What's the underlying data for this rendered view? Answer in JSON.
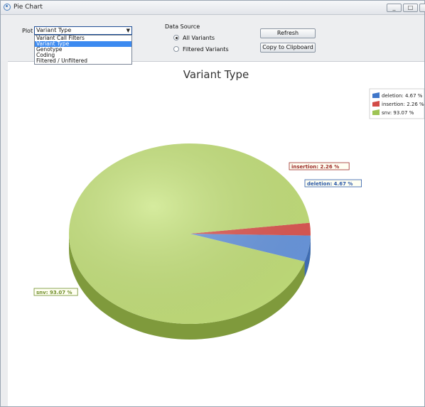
{
  "window": {
    "title": "Pie Chart",
    "minimize_glyph": "_",
    "maximize_glyph": "□",
    "close_glyph": "X"
  },
  "toolbar": {
    "plot_label": "Plot",
    "plot_selected": "Variant Type",
    "plot_options": [
      "Variant Call Filters",
      "Variant Type",
      "Genotype",
      "Coding",
      "Filtered / Unfiltered"
    ],
    "plot_selected_index": 1,
    "data_source_label": "Data Source",
    "data_source_options": [
      "All Variants",
      "Filtered Variants"
    ],
    "data_source_selected": "All Variants",
    "refresh_label": "Refresh",
    "copy_label": "Copy to Clipboard"
  },
  "icons": {
    "app": "pie-chart-app-icon",
    "dropdown": "chevron-down-icon"
  },
  "chart_data": {
    "type": "pie",
    "title": "Variant Type",
    "slices": [
      {
        "name": "deletion",
        "value": 4.67,
        "label": "deletion: 4.67 %",
        "color": "#6c9be4",
        "side_color": "#3f6cb3",
        "label_color": "#2a58a8"
      },
      {
        "name": "insertion",
        "value": 2.26,
        "label": "insertion: 2.26 %",
        "color": "#e25a55",
        "side_color": "#a63a36",
        "label_color": "#9c2b27"
      },
      {
        "name": "snv",
        "value": 93.07,
        "label": "snv: 93.07 %",
        "color": "#c8e57e",
        "side_color": "#7f9a3c",
        "label_color": "#6f8e2a"
      }
    ],
    "legend": {
      "position": "top-right",
      "entries": [
        "deletion: 4.67 %",
        "insertion: 2.26 %",
        "snv: 93.07 %"
      ],
      "colors": [
        "#3f76c9",
        "#d24b46",
        "#9ec454"
      ]
    },
    "style": "3d"
  }
}
